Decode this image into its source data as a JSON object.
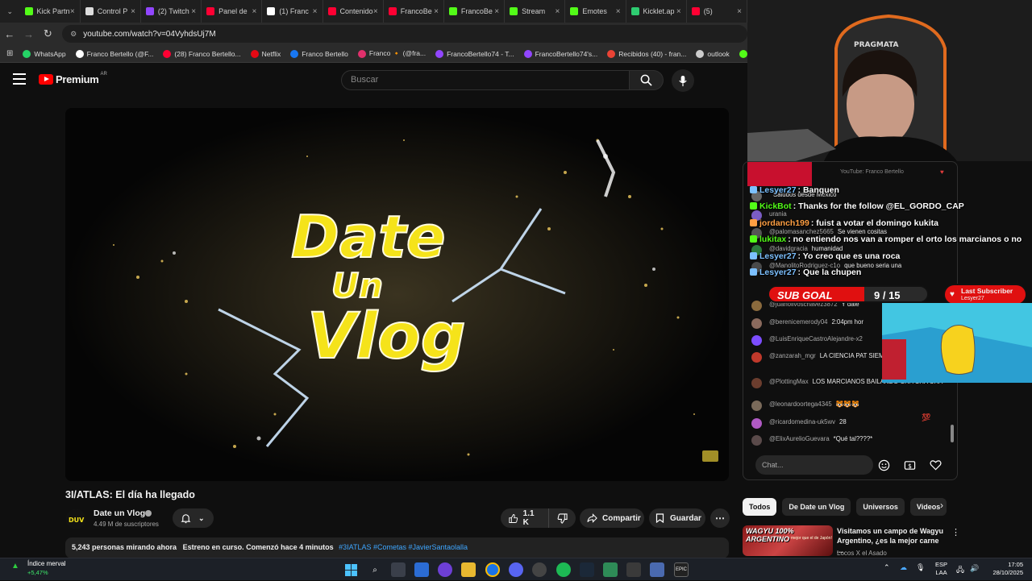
{
  "browser": {
    "tabs": [
      {
        "label": "Kick Partn",
        "color": "#53fc18"
      },
      {
        "label": "Control P",
        "color": "#dddddd"
      },
      {
        "label": "(2) Twitch",
        "color": "#9146ff"
      },
      {
        "label": "Panel de",
        "color": "#ff0033"
      },
      {
        "label": "(1) Franc",
        "color": "#ffffff"
      },
      {
        "label": "Contenido",
        "color": "#ff0033"
      },
      {
        "label": "FrancoBe",
        "color": "#ff0033"
      },
      {
        "label": "FrancoBe",
        "color": "#53fc18"
      },
      {
        "label": "Stream",
        "color": "#53fc18"
      },
      {
        "label": "Emotes",
        "color": "#53fc18"
      },
      {
        "label": "Kicklet.ap",
        "color": "#2ecc71"
      },
      {
        "label": "(5)",
        "color": "#ff0033"
      }
    ],
    "url": "youtube.com/watch?v=04VyhdsUj7M",
    "bookmarks": [
      {
        "label": "WhatsApp",
        "color": "#25d366"
      },
      {
        "label": "Franco Bertello (@F...",
        "color": "#ffffff"
      },
      {
        "label": "(28) Franco Bertello...",
        "color": "#ff0033"
      },
      {
        "label": "Netflix",
        "color": "#e50914"
      },
      {
        "label": "Franco Bertello",
        "color": "#1877f2"
      },
      {
        "label": "Franco 🔸 (@fra...",
        "color": "#e1306c"
      },
      {
        "label": "FrancoBertello74 - T...",
        "color": "#9146ff"
      },
      {
        "label": "FrancoBertello74's...",
        "color": "#9146ff"
      },
      {
        "label": "Recibidos (40) - fran...",
        "color": "#ea4335"
      },
      {
        "label": "outlook",
        "color": "#cccccc"
      },
      {
        "label": "Aler",
        "color": "#53fc18"
      }
    ]
  },
  "youtube": {
    "logo_text": "Premium",
    "logo_region": "AR",
    "search_placeholder": "Buscar",
    "video": {
      "title": "3I/ATLAS: El día ha llegado",
      "thumbnail_text_line1": "Date",
      "thumbnail_text_line2": "Un",
      "thumbnail_text_line3": "Vlog",
      "channel": "Date un Vlog",
      "subscribers": "4.49 M de suscriptores",
      "likes": "1.1 K",
      "share_label": "Compartir",
      "save_label": "Guardar",
      "viewers": "5,243 personas mirando ahora",
      "status": "Estreno en curso. Comenzó hace 4 minutos",
      "hashtags": "#3IATLAS #Cometas #JavierSantaolalla"
    },
    "chat": {
      "header_text": "YouTube: Franco Bertello",
      "messages": [
        {
          "author": "",
          "text": "Saludos desde México",
          "color": "#666666"
        },
        {
          "author": "urania",
          "text": "",
          "color": "#7a5cc4"
        },
        {
          "author": "@palomasanchez5665",
          "text": "Se vienen cositas",
          "color": "#555555"
        },
        {
          "author": "@davidgracia",
          "text": "humanidad",
          "color": "#2c7a3d"
        },
        {
          "author": "@ManolitoRodriguez-c1o",
          "text": "que bueno seria una",
          "color": "#4a4a4a"
        },
        {
          "author": "@juanolivoschavez3872",
          "text": "Y dale",
          "color": "#8a6a3d"
        },
        {
          "author": "@berenicemerody04",
          "text": "2:04pm hor",
          "color": "#8a6a5d"
        },
        {
          "author": "@LuisEnriqueCastroAlejandre-x2",
          "text": "",
          "color": "#7c4dff"
        },
        {
          "author": "@zanzarah_mgr",
          "text": "LA CIENCIA PAT SIEMPRE 😵‍💫",
          "color": "#c0392b"
        },
        {
          "author": "@PlottingMax",
          "text": "LOS MARCIANOS BAILANDO CHA CHA CHA",
          "color": "#6b3d2e"
        },
        {
          "author": "@leonardoortega4345",
          "text": "🐯🐯🐯",
          "color": "#7a6a5a"
        },
        {
          "author": "@ricardomedina-uk5wv",
          "text": "28",
          "color": "#b05ac4"
        },
        {
          "author": "@ElixAurelioGuevara",
          "text": "*Qué tal????*",
          "color": "#5a4a4a"
        }
      ],
      "input_placeholder": "Chat..."
    },
    "chips": [
      "Todos",
      "De Date un Vlog",
      "Universos",
      "Videos"
    ],
    "recommendation": {
      "thumb_text": "WAGYU 100% ARGENTINO",
      "thumb_subtext": "mejor que el de Japón!",
      "title": "Visitamos un campo de Wagyu Argentino, ¿es la mejor carne ...",
      "channel": "Locos X el Asado"
    }
  },
  "stream_overlay": {
    "lines": [
      {
        "user": "Lesyer27",
        "text": ": Banquen",
        "color": "#7cc0ff"
      },
      {
        "user": "KickBot",
        "text": ": Thanks for the follow @EL_GORDO_CAP",
        "color": "#53fc18"
      },
      {
        "user": "jordanch199",
        "text": ": fuist a votar el domingo kukita",
        "color": "#ff9f43"
      },
      {
        "user": "lukitax",
        "text": ": no entiendo nos van a romper el orto los marcianos o no",
        "color": "#53fc18"
      },
      {
        "user": "Lesyer27",
        "text": ": Yo creo que es una roca",
        "color": "#7cc0ff"
      },
      {
        "user": "Lesyer27",
        "text": ": Que la chupen",
        "color": "#7cc0ff"
      }
    ],
    "sub_goal_label": "SUB GOAL",
    "sub_goal_count": "9 / 15",
    "sub_goal_progress": 0.6,
    "last_subscriber_title": "Last Subscriber",
    "last_subscriber_name": "Lesyer27",
    "webcam_brand": "PRAGMATA"
  },
  "taskbar": {
    "widget_name": "Índice merval",
    "widget_value": "+5,47%",
    "language": "ESP",
    "language_sub": "LAA",
    "time": "17:05",
    "date": "28/10/2025"
  }
}
